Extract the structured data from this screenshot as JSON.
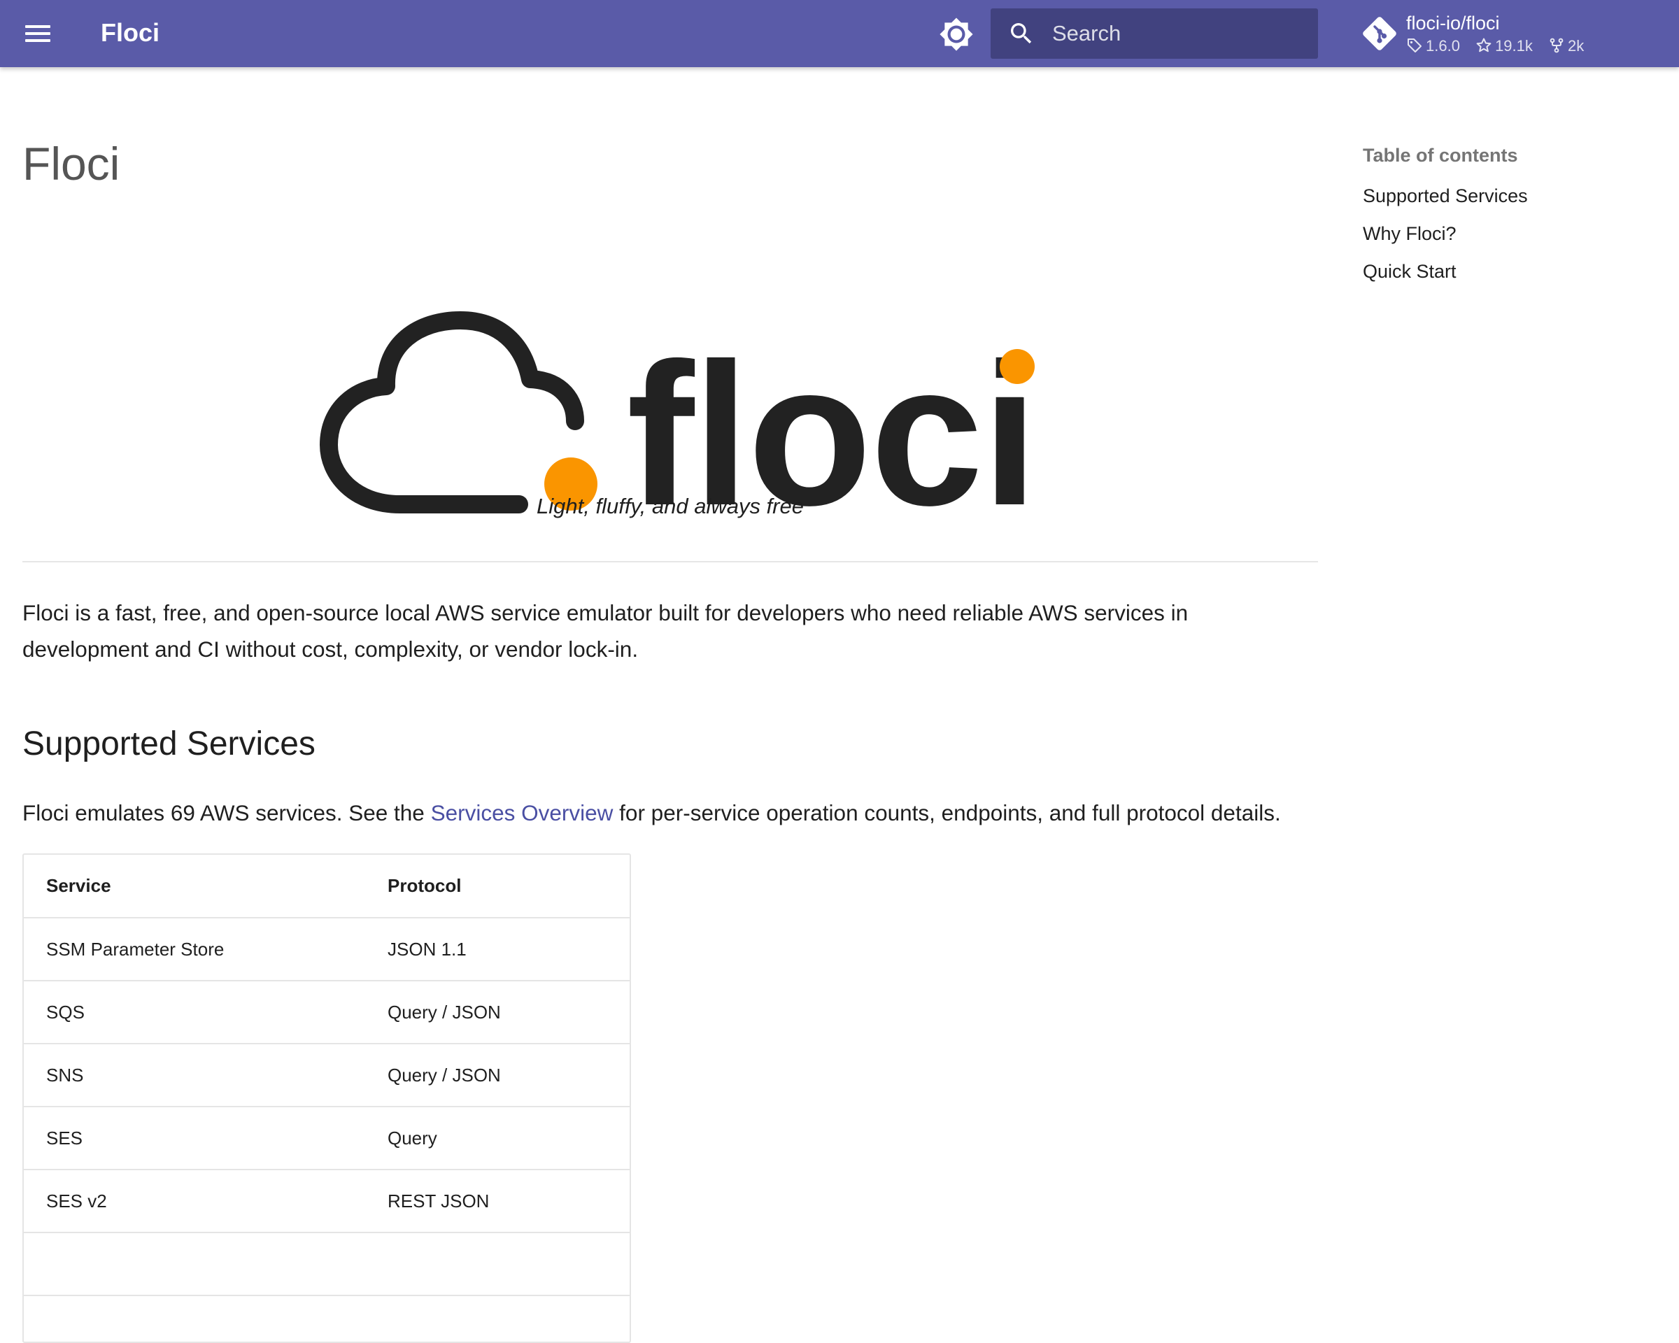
{
  "header": {
    "site_title": "Floci",
    "search_placeholder": "Search",
    "repo": {
      "name": "floci-io/floci",
      "version": "1.6.0",
      "stars": "19.1k",
      "forks": "2k"
    },
    "accent_color": "#5a5ba8"
  },
  "page": {
    "title": "Floci",
    "logo_text": "floci",
    "tagline": "Light, fluffy, and always free",
    "intro": "Floci is a fast, free, and open-source local AWS service emulator built for developers who need reliable AWS services in development and CI without cost, complexity, or vendor lock-in."
  },
  "supported": {
    "heading": "Supported Services",
    "text_before": "Floci emulates 69 AWS services. See the ",
    "link_text": "Services Overview",
    "text_after": " for per-service operation counts, endpoints, and full protocol details.",
    "table": {
      "headers": [
        "Service",
        "Protocol"
      ],
      "rows": [
        [
          "SSM Parameter Store",
          "JSON 1.1"
        ],
        [
          "SQS",
          "Query / JSON"
        ],
        [
          "SNS",
          "Query / JSON"
        ],
        [
          "SES",
          "Query"
        ],
        [
          "SES v2",
          "REST JSON"
        ],
        [
          "",
          ""
        ]
      ]
    }
  },
  "toc": {
    "title": "Table of contents",
    "items": [
      "Supported Services",
      "Why Floci?",
      "Quick Start"
    ]
  },
  "icons": {
    "menu": "hamburger-menu-icon",
    "theme": "brightness-icon",
    "search": "search-icon",
    "repo": "git-icon",
    "tag": "tag-icon",
    "star": "star-icon",
    "fork": "fork-icon"
  }
}
